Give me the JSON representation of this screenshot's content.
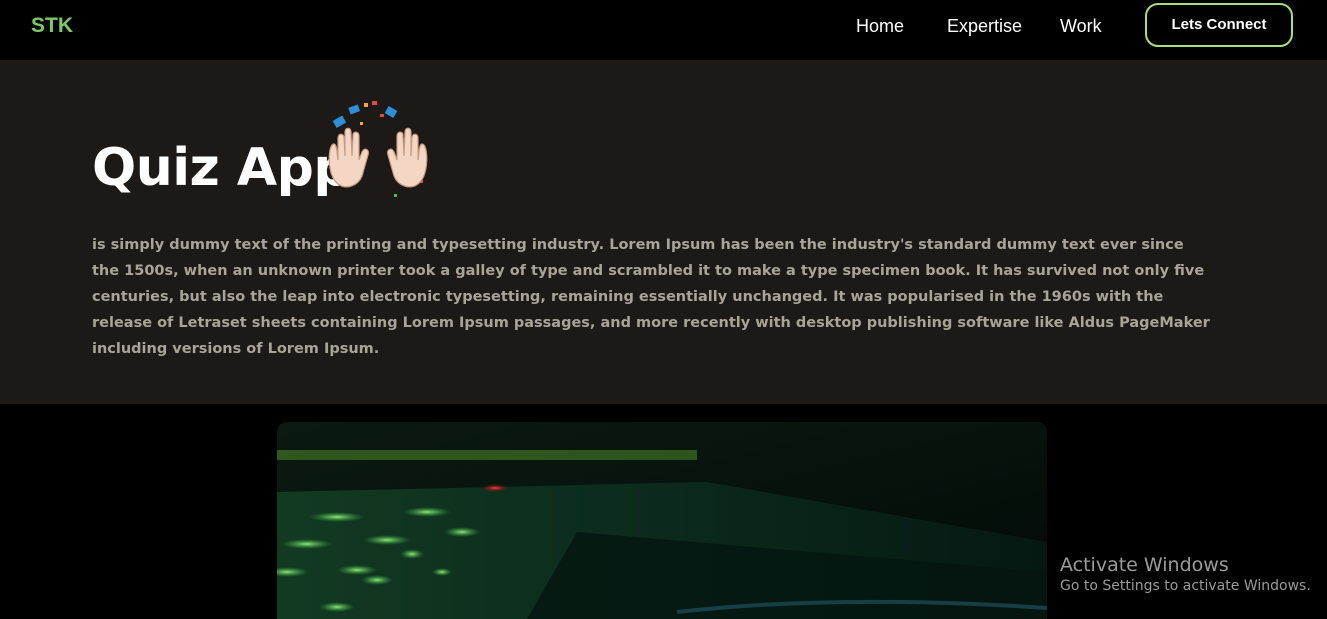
{
  "nav": {
    "brand": "STK",
    "links": [
      "Home",
      "Expertise",
      "Work"
    ],
    "cta_label": "Lets Connect",
    "brand_color": "#7cc86a",
    "cta_border_color": "#a8df7a"
  },
  "hero": {
    "title": "Quiz App",
    "title_icon": "raising-hands-celebration-icon",
    "description": "is simply dummy text of the printing and typesetting industry. Lorem Ipsum has been the industry's standard dummy text ever since the 1500s, when an unknown printer took a galley of type and scrambled it to make a type specimen book. It has survived not only five centuries, but also the leap into electronic typesetting, remaining essentially unchanged. It was popularised in the 1960s with the release of Letraset sheets containing Lorem Ipsum passages, and more recently with desktop publishing software like Aldus PageMaker including versions of Lorem Ipsum.",
    "background_color": "#1d1916"
  },
  "project_image": {
    "subject": "laptop keyboard with green backlight"
  },
  "watermark": {
    "title": "Activate Windows",
    "subtitle": "Go to Settings to activate Windows."
  }
}
